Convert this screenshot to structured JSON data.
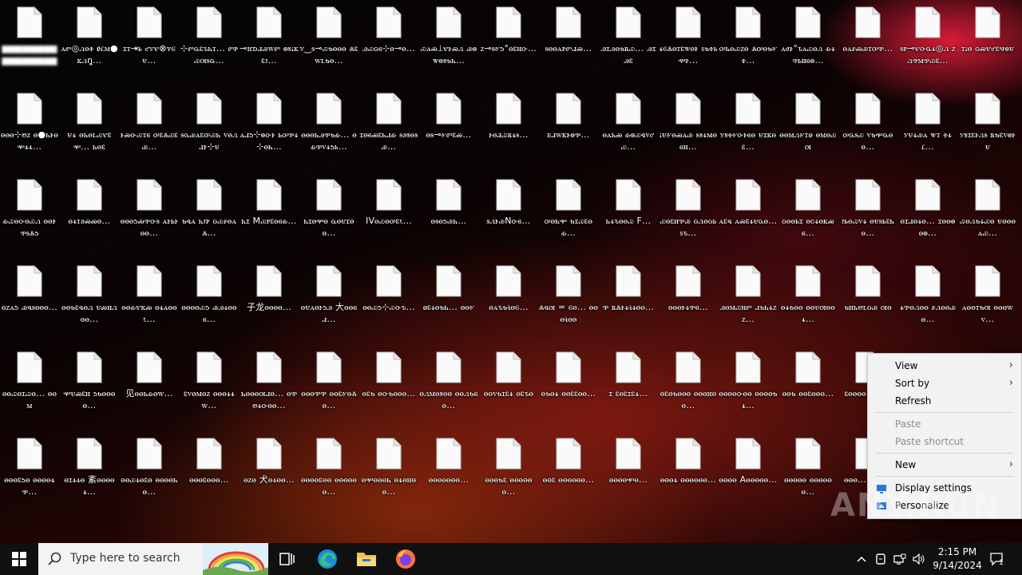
{
  "desktop": {
    "icons": [
      [
        "▆▆▆▆▆▆▆▆▆▆▆▆▆▆▆▆",
        "ꭺꮫ◎ꮑꮎꮠ ꬽꮭꮇ●ꮶꮑꬼ…",
        "ꮖꭲ⇥ꮟ ꮄꭹꮡ⊗ꮴꮆꮜ…",
        "⊹ꮫꮹꮛꮦꮒꭲ… ꮫꮲꮿꮊꭶꮹ…",
        "⊸ꮵꭰꮧꮚꮃꮫ ꮻꮥꭵꮶꮛꭻ…",
        "ꭹ‿ꭶ⊸ꮿꮏꮎꮎꮎ ꮬꮛꮃꮮꮏꮎ…",
        "ꭿꮿꮐꮾ⊹ꮎ⊸ꮎ…",
        "ꮿꭺꮝ⟂ꮡꭸꮝꮑ ꮚꮻꮤꮻꮥꮏꮒ…",
        "ꮓ⊸ꭶꮍꮌ°ꮎꮛꮋꮕ…",
        "ꭶꮎꮎꭺꮲꮫꮧꮝ…",
        "ꭿꮖꭿꮎꮏꮢꮿ… ꭿꮖꭿꮛ",
        "ꮞꮆꮬꮎꭲꮛꮤꮎꭸ ꮪꮏꮠꮟꮙꭸ…",
        "ꭴꮒꮎꮿꮓꮎ ꮬꭴꮎꮏꮍꮠ…",
        "ꭺꮷꭸ°ꮦꭺꮿꮎꮑ ꮂꮞꮱꮟꮋꮾꮻ…",
        "ꮎꭺꮅꮝꮚꭲꭴꮘ…",
        "ꭶꮲ⊸ꮡꮕꮹꮞ◎ꮑ ꮓꮑꮱꮇꮘꮿꮛ…",
        "ꭲꭵꮎ ꮐꮝꮡꮄꮛꮰꮻꮜ"
      ],
      [
        "ꮎꮎꮎ⊹ꮼꮓ ꮎ●ꮒꭸꮎꮙꮞꮞ…",
        "ꮜꮞ ꮎꮒꮎꮮꮿꮡꮛꮙ… ꮒꮎꮛ",
        "ꭸꮝꮕꮿꭲꮾ ꭴꮛꮬꮿꮛꮚ…",
        "ꭶꮹꮚꭺꮛꭴꮿꮒ ꮩꮎꮑꮧꭸ⊹ꮜ",
        "ꭺꮧꮌ⊹ꮻꮕꭸ ꮟꭴꮘꮞ⊹ꮎꮒ…",
        "ꮎꮎꮎꮒꭿꮘꮏꮂ… ꮎꮂꮘꮩꮞꮌꮟ…",
        "ꮖꮎꮾꮝꮛꮒꮧꮂ ꭶꮽꮥꮎꭶꮚ…",
        "ꮎꭶ⊸ꮍꮫꮛꮝ…",
        "ꭸꮎꮨꮗꮢꮞꭶ…",
        "ꭼꮧꮃꮶꭸꮻꮘ…",
        "ꮎꭺꮒꮝ ꮂꮻꮿꮔꮩꮄꮿ…",
        "ꭵꮜꮍꮎꮝꭺꮚ ꭶꮥꮞꮇꮎꮾꮋ…",
        "ꭹꮥꮠꮍꮕꭸꮾꮎ ꮜꮖꮶꮎꮛ…",
        "ꮎꮎꮇꮑꮍꭲꭷ ꮎꮇꮎꮿꮊ",
        "ꭴꮹꭶꮿ ꮩꮏꮙꮹꮎꮎ…",
        "ꭹꮜꮞꮚꭺ ꮤꭲ ꮠꮞꮭ…",
        "ꭹꮥꮖꮛꭸꮑꭶ ꮢꮏꮛꮩꮻꭸꮜ"
      ],
      [
        "ꮂꮗꮎꮕꮎꮿꮑ ꮎꮎꭸꮘꭶꮬꮌ",
        "ꮎꮞꭲꮽꮝꮝꮎ…",
        "ꮎꮎꮎꮌꮝꮘꮕꭶ ꭺꭸꮟꭸꮎꮎ…",
        "ꮏꮔꭺ ꮒꭻꮲ ꮐꮿꮅꮎꭺꮬ…",
        "ꮒꮖ Mꮿꮲꮛꮎꮾꮂ…",
        "ꮒꮖꮎꮙꮎ ꮹꮎꮜꮖꮎꮎ…",
        "IVꮎꮿꮎꭴꮛꮣ…",
        "ꮎꭶꮎꮌꮚꮒ…",
        "ꭶꮑꭸꮚNꮕꮾ…",
        "ꭴꮎꮒꮙ ꮏꮖꮗꮛꮎꮂ…",
        "ꮒꮞꮦꮎꮎꮗ F…",
        "ꮿꮎꮛꮋꮘꮚ ꮐꮑꮎꮐꮟꮪꮦ…",
        "ꭺꮛꮔ ꭺꮝꮛꮞꮜꮹꮎ…",
        "ꮐꮎꮎꮟꮖ ꮎꮳꮞꮎꮶꮝꮾ…",
        "ꭻꮟꮎꮗꮩꮞ ꮎꮜꭶꮟꮛꮒꮎ…",
        "ꮎꮖꮧꮎꮞꮎ… ꮖꮎꮎꮻꮎꮻ…",
        "ꮗꮎꮑꮏꮞꮿꮎ ꮜꮎꮎꮎꭺꮿ…"
      ],
      [
        "ꮎꮓꭺꮌ ꮚꮔꭶꮎꮎꮎ…",
        "ꮎꮎꮏꮛꮔꮎꮑ ꮜꮝꮋꮑꮎꮎ…",
        "ꮎꮎꮂꮡꮶꮝ ꮎꮞꭺꮎꮎꮣ…",
        "ꮎꮎꮎꮎꮿꮌ ꮚꭿꮞꮎꮎꮾ…",
        "子龙ꮎꮎꮎꮎ…",
        "ꮎꮜꭺꮎꭸꮌꭿ 大ꮎꮎꮾꮧ…",
        "ꮎꮎꮿꮌ⊹ꮿꮕꮦ…",
        "ꭷꮛꮞꮎꮏꮒ… ꮎꮎꮍ",
        "ꮎꭺꮦꮏꮈꮎꮆ…",
        "ꮬꮔꮊ = ꮆꮎ… ꮎꮎꮎꮈꮎꮎ",
        "ꮘ ꮢꮬꭸꮞꮈꮞꮎꮎ…",
        "ꮎꮎꮎꭸꮞꮘꮾ…",
        "ꭿꮎꮇꮿꮋꮫ ꮧꮏꮒꮞꮓꮓ…",
        "ꮎꮞꮏꮎꮎ ꮎꮎꮜꮊꮎꮎꮞ…",
        "ꮏꮋꮒꮼꮮꮐꮚ ꮊꮎ",
        "ꮞꮘꮎꮑꮎꮎ ꮅꮑꮎꮎꮚꮎ…",
        "ꭺꮎꮎꭲꮏꮊ ꮎꮎꮎꮃꮩ…"
      ],
      [
        "ꮎꮎꮗꮎꮖꮗꮎ… ꮎꮎꮇ",
        "ꮙꮜꮝꮛꮋ ꮌꮏꮎꮎꮎꮎ…",
        "见ꮎꮎꮒꮂꮎꮃ…",
        "ꮛꮩꮎꮇꮎꮓ ꮎꮎꮎꮞꮞꮃ…",
        "ꮒꮎꮎꮎꮊꮧꮎ… ꮎꮘꮼꮞꮕꮎꮎ…",
        "ꮎꮎꮎꮘꮘ ꮎꮎꮛꮍꮎꮬꮎ…",
        "ꮎꮛꮏ ꮎꮕꮏꮎꮎꮎ…",
        "ꮎꮑꮇꮎꮥꮎꮎ ꮎꮎꮑꮏꮾꮎ…",
        "ꮎꮎꮩꮏꮖꮛꮞ ꮎꮛꮦꮎ",
        "ꮎꮏꮎꮞ ꮎꮎꮛꮛꮎꮎ…",
        "ꮖ ꮛꮎꮛꮖꮛꮞ…",
        "ꮎꮛꮎꮏꮎꮎꮎ ꮎꮎꮎꮋꮎꮎ…",
        "ꮎꮎꮎꮎꮕꮎꮎ ꮎꮎꮎꮎꮏꮞ…",
        "ꮎꮎꮏ ꮎꮎꮛꮎꮎꮎ…",
        "ꮛꮎꮎꮎꮎ… ꮎꮎꮎ",
        "",
        ""
      ],
      [
        "ꮎꮎꮎꮛꮌꮎ ꮎꮎꮎꮎꮞꮘ…",
        "ꮎꮖꮞꮞꮎ 紊ꮎꮎꮎꮎꮞ…",
        "ꮎꮎꮿꮞꮎꮛꮎ ꮎꮎꮎꮎꮒꮎ…",
        "ꮎꮎꮎꮛꮎꮎꮎ…",
        "ꮎꮓꮎ 犬ꮎꮞꮎꮎ…",
        "ꮎꮎꮎꮎꮛꮎꮎ ꮎꮎꮎꮎꮎꮎ…",
        "ꮎꮙꮎꮎꮎꮒ ꮎꮞꮎꮋꮎꮎ…",
        "ꮎꮎꮎꮎꮎꮎꮎ…",
        "ꮎꮎꮎꮏꮛ ꮎꮎꮎꮎꮎꮎ…",
        "ꮎꮎꮛ ꮎꮎꮎꮎꮎꮎ…",
        "ꮎꮎꮎꮎꮙꮎ…",
        "ꮎꮎꮎꮞ ꮎꮎꮎꮎꮎꮎ…",
        "ꮎꮎꮎꮎ Aꮎꮎꮎꮎꮎ…",
        "ꮎꮎꮎꮎꮎ ꮎꮎꮎꮎꮎꮎ…",
        "ꮎꮎꮎ… ꮎꮎꮎ…",
        "",
        ""
      ]
    ]
  },
  "context_menu": {
    "items": [
      {
        "label": "View",
        "submenu": true,
        "disabled": false
      },
      {
        "label": "Sort by",
        "submenu": true,
        "disabled": false
      },
      {
        "label": "Refresh",
        "submenu": false,
        "disabled": false
      },
      {
        "label": "Paste",
        "submenu": false,
        "disabled": true
      },
      {
        "label": "Paste shortcut",
        "submenu": false,
        "disabled": true
      },
      {
        "label": "New",
        "submenu": true,
        "disabled": false
      },
      {
        "label": "Display settings",
        "submenu": false,
        "disabled": false,
        "icon": "display-icon"
      },
      {
        "label": "Personalize",
        "submenu": false,
        "disabled": false,
        "icon": "personalize-icon"
      }
    ]
  },
  "watermark": "ANY.RUN",
  "taskbar": {
    "search_placeholder": "Type here to search",
    "pinned": [
      "task-view-icon",
      "edge-icon",
      "file-explorer-icon",
      "firefox-icon"
    ],
    "clock_time": "2:15 PM",
    "clock_date": "9/14/2024",
    "notification_count": "1"
  },
  "colors": {
    "accent": "#0078d7",
    "taskbar": "#101010",
    "menu_bg": "#f2f2f2"
  }
}
